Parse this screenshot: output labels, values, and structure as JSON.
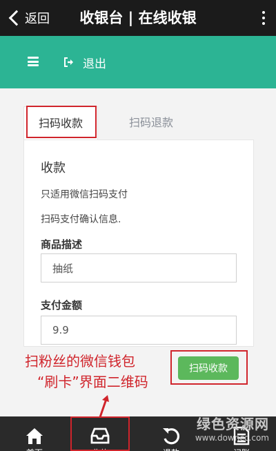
{
  "navbar": {
    "back_label": "返回",
    "title": "收银台 | 在线收银"
  },
  "appbar": {
    "logout_label": "退出"
  },
  "tabs": [
    {
      "label": "扫码收款",
      "active": true
    },
    {
      "label": "扫码退款",
      "active": false
    }
  ],
  "card": {
    "title": "收款",
    "line1": "只适用微信扫码支付",
    "line2": "扫码支付确认信息.",
    "product_label": "商品描述",
    "product_value": "抽纸",
    "amount_label": "支付金额",
    "amount_value": "9.9",
    "submit_label": "扫码收款"
  },
  "annotation": {
    "line1": "扫粉丝的微信钱包",
    "line2": "“刷卡”界面二维码"
  },
  "tabbar": {
    "items": [
      {
        "label": "首页",
        "icon": "home-icon"
      },
      {
        "label": "收款",
        "icon": "inbox-icon"
      },
      {
        "label": "退款",
        "icon": "refresh-icon"
      },
      {
        "label": "记账",
        "icon": "list-icon"
      }
    ]
  },
  "watermark": {
    "line1": "绿色资源网",
    "line2": "www.downcc.com"
  },
  "colors": {
    "navbar": "#1b1b1b",
    "accent_teal": "#2cb494",
    "submit_green": "#5cb85c",
    "highlight_red": "#d0242b",
    "tabbar": "#2a2a2a"
  }
}
